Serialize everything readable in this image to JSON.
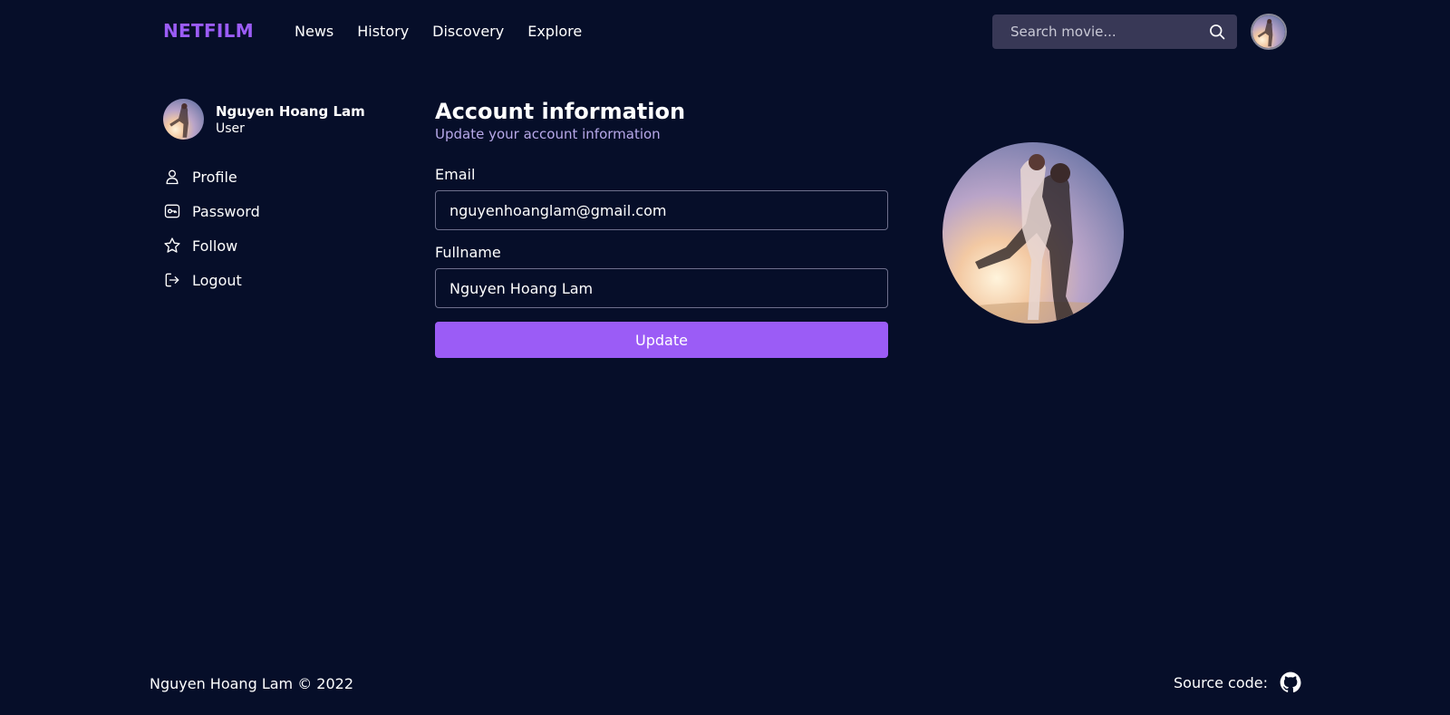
{
  "header": {
    "logo": "NETFILM",
    "nav": [
      {
        "label": "News"
      },
      {
        "label": "History"
      },
      {
        "label": "Discovery"
      },
      {
        "label": "Explore"
      }
    ],
    "search_placeholder": "Search movie...",
    "search_icon": "search-icon"
  },
  "sidebar": {
    "user_name": "Nguyen Hoang Lam",
    "user_role": "User",
    "menu": [
      {
        "label": "Profile",
        "icon": "user-icon"
      },
      {
        "label": "Password",
        "icon": "key-icon"
      },
      {
        "label": "Follow",
        "icon": "star-icon"
      },
      {
        "label": "Logout",
        "icon": "logout-icon"
      }
    ]
  },
  "main": {
    "title": "Account information",
    "subtitle": "Update your account information",
    "email_label": "Email",
    "email_value": "nguyenhoanglam@gmail.com",
    "fullname_label": "Fullname",
    "fullname_value": "Nguyen Hoang Lam",
    "update_label": "Update"
  },
  "footer": {
    "copyright": "Nguyen Hoang Lam © 2022",
    "source_label": "Source code:",
    "source_icon": "github-icon"
  },
  "colors": {
    "background": "#060e29",
    "accent": "#9b5cf6",
    "search_bg": "#383856",
    "subtitle": "#b7a8e8"
  }
}
